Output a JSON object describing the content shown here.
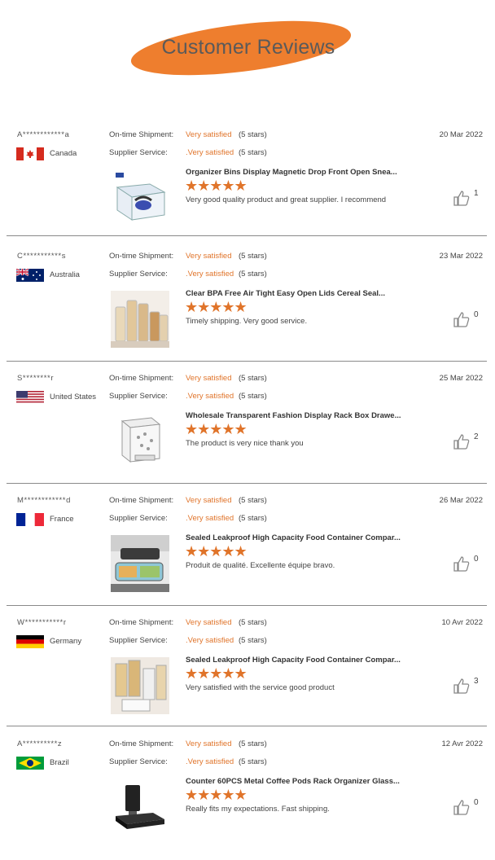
{
  "header": {
    "title": "Customer Reviews"
  },
  "labels": {
    "shipment": "On-time Shipment:",
    "service": "Supplier Service:"
  },
  "colors": {
    "accent": "#e0742a",
    "header_pill": "#ee7e2e"
  },
  "reviews": [
    {
      "user": "A************a",
      "country": "Canada",
      "flag": "canada-flag",
      "shipment_value": "Very satisfied",
      "shipment_stars": "(5 stars)",
      "service_value": ".Very satisfied",
      "service_stars": "(5 stars)",
      "date": "20 Mar 2022",
      "product_title": "Organizer Bins Display Magnetic Drop Front Open Snea...",
      "rating": 5,
      "stars_text": "★★★★★",
      "comment": "Very good quality product and great supplier. I recommend",
      "likes": "1"
    },
    {
      "user": "C***********s",
      "country": "Australia",
      "flag": "australia-flag",
      "shipment_value": "Very satisfied",
      "shipment_stars": "(5 stars)",
      "service_value": ".Very satisfied",
      "service_stars": "(5 stars)",
      "date": "23 Mar 2022",
      "product_title": "Clear BPA Free Air Tight Easy Open Lids Cereal Seal...",
      "rating": 5,
      "stars_text": "★★★★★",
      "comment": "Timely shipping. Very good service.",
      "likes": "0"
    },
    {
      "user": "S********r",
      "country": "United States",
      "flag": "usa-flag",
      "shipment_value": "Very satisfied",
      "shipment_stars": "(5 stars)",
      "service_value": ".Very satisfied",
      "service_stars": "(5 stars)",
      "date": "25 Mar 2022",
      "product_title": "Wholesale Transparent Fashion Display Rack Box Drawe...",
      "rating": 5,
      "stars_text": "★★★★★",
      "comment": "The product is very nice thank you",
      "likes": "2"
    },
    {
      "user": "M************d",
      "country": "France",
      "flag": "france-flag",
      "shipment_value": "Very satisfied",
      "shipment_stars": "(5 stars)",
      "service_value": ".Very satisfied",
      "service_stars": "(5 stars)",
      "date": "26 Mar 2022",
      "product_title": "Sealed Leakproof High Capacity Food Container Compar...",
      "rating": 5,
      "stars_text": "★★★★★",
      "comment": "Produit de qualité. Excellente équipe bravo.",
      "likes": "0"
    },
    {
      "user": "W***********r",
      "country": "Germany",
      "flag": "germany-flag",
      "shipment_value": "Very satisfied",
      "shipment_stars": "(5 stars)",
      "service_value": ".Very satisfied",
      "service_stars": "(5 stars)",
      "date": "10 Avr 2022",
      "product_title": "Sealed Leakproof High Capacity Food Container Compar...",
      "rating": 5,
      "stars_text": "★★★★★",
      "comment": "Very satisfied with the service good product",
      "likes": "3"
    },
    {
      "user": "A**********z",
      "country": "Brazil",
      "flag": "brazil-flag",
      "shipment_value": "Very satisfied",
      "shipment_stars": "(5 stars)",
      "service_value": ".Very satisfied",
      "service_stars": "(5 stars)",
      "date": "12 Avr 2022",
      "product_title": "Counter 60PCS Metal Coffee Pods Rack Organizer Glass...",
      "rating": 5,
      "stars_text": "★★★★★",
      "comment": "Really fits my expectations. Fast shipping.",
      "likes": "0"
    }
  ]
}
